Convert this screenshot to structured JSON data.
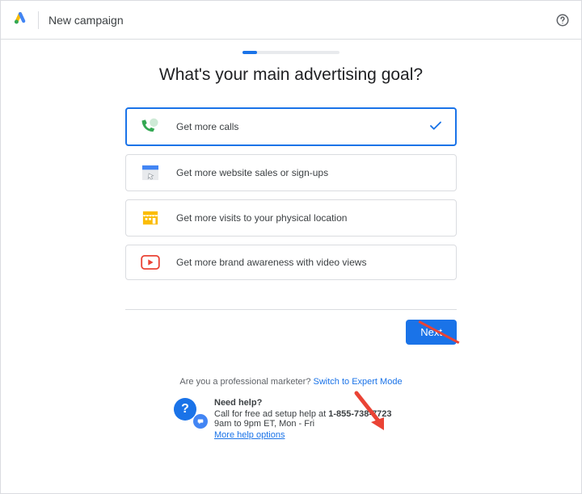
{
  "header": {
    "title": "New campaign"
  },
  "page": {
    "title": "What's your main advertising goal?"
  },
  "options": [
    {
      "label": "Get more calls",
      "selected": true,
      "icon": "phone"
    },
    {
      "label": "Get more website sales or sign-ups",
      "selected": false,
      "icon": "browser"
    },
    {
      "label": "Get more visits to your physical location",
      "selected": false,
      "icon": "storefront"
    },
    {
      "label": "Get more brand awareness with video views",
      "selected": false,
      "icon": "video"
    }
  ],
  "next": {
    "label": "Next"
  },
  "expert": {
    "prompt": "Are you a professional marketer? ",
    "link": "Switch to Expert Mode"
  },
  "help": {
    "title": "Need help?",
    "line1_prefix": "Call for free ad setup help at ",
    "phone": "1-855-738-7723",
    "hours": "9am to 9pm ET, Mon - Fri",
    "more": "More help options"
  }
}
